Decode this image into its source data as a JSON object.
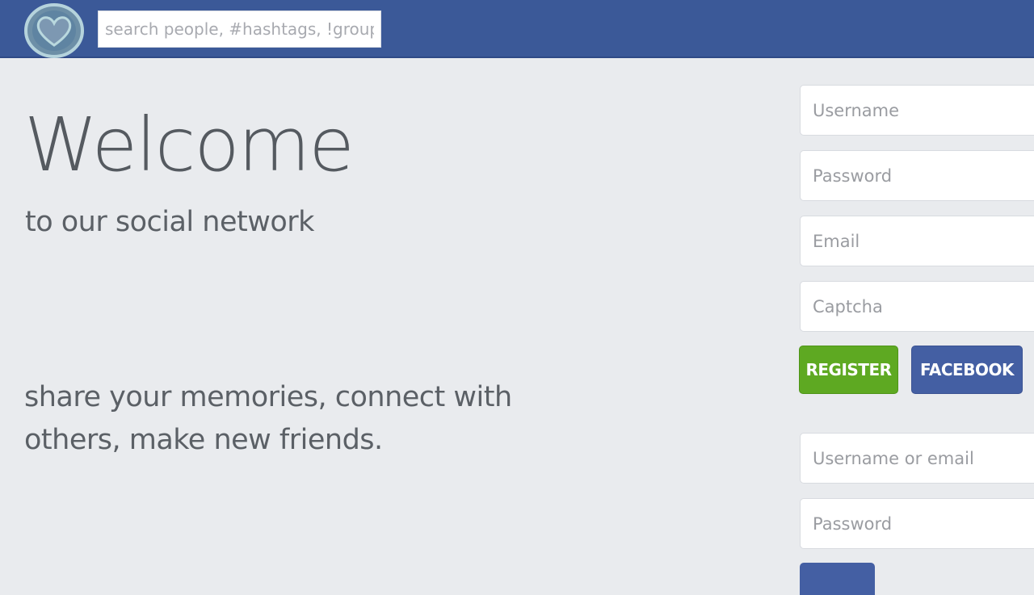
{
  "header": {
    "search_placeholder": "search people, #hashtags, !groups",
    "logo_icon": "heart-logo-icon"
  },
  "hero": {
    "title": "Welcome",
    "subtitle": "to our social network",
    "tagline": "share your memories, connect with others, make new friends."
  },
  "register": {
    "username_placeholder": "Username",
    "password_placeholder": "Password",
    "email_placeholder": "Email",
    "captcha_placeholder": "Captcha",
    "register_label": "REGISTER",
    "facebook_label": "FACEBOOK"
  },
  "login": {
    "username_placeholder": "Username or email",
    "password_placeholder": "Password"
  },
  "colors": {
    "topbar": "#3b5998",
    "background": "#e9ebee",
    "register_button": "#5ea922",
    "facebook_button": "#445fa3"
  }
}
